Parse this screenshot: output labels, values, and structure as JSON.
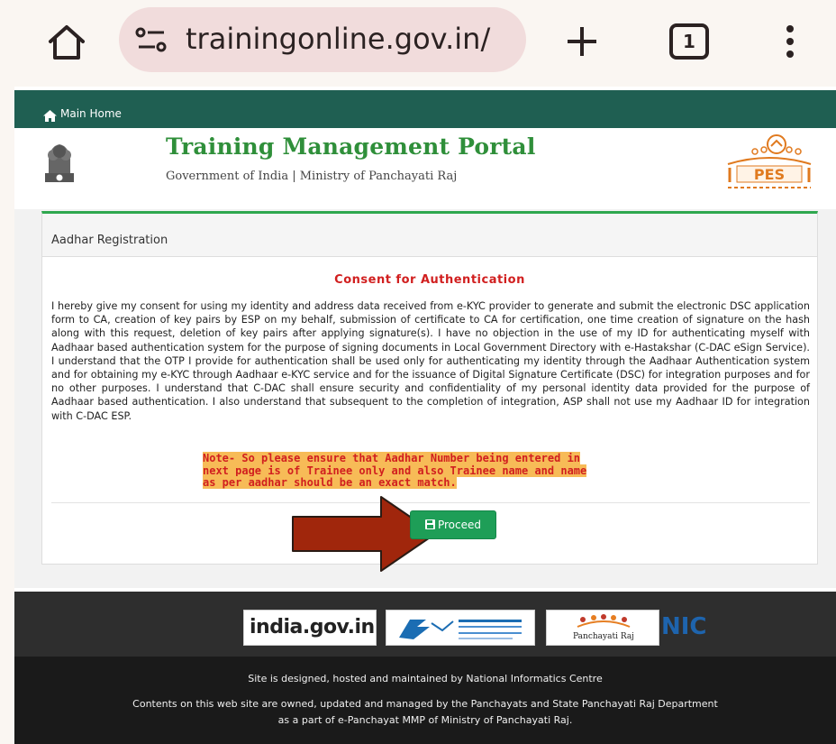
{
  "browser": {
    "url": "trainingonline.gov.in/",
    "tab_count": "1"
  },
  "nav": {
    "home_link": "Main Home"
  },
  "header": {
    "title": "Training Management Portal",
    "subtitle": "Government of India | Ministry of Panchayati Raj",
    "emblem_caption": "सत्यमेव जयते",
    "right_logo_text": "PES"
  },
  "card": {
    "title": "Aadhar Registration",
    "consent_title": "Consent for Authentication",
    "consent_text": "I hereby give my consent for using my identity and address data received from e-KYC provider to generate and submit the electronic DSC application form to CA, creation of key pairs by ESP on my behalf, submission of certificate to CA for certification, one time creation of signature on the hash along with this request, deletion of key pairs after applying signature(s). I have no objection in the use of my ID for authenticating myself with Aadhaar based authentication system for the purpose of signing documents in Local Government Directory with e-Hastakshar (C-DAC eSign Service). I understand that the OTP I provide for authentication shall be used only for authenticating my identity through the Aadhaar Authentication system and for obtaining my e-KYC through Aadhaar e-KYC service and for the issuance of Digital Signature Certificate (DSC) for integration purposes and for no other purposes. I understand that C-DAC shall ensure security and confidentiality of my personal identity data provided for the purpose of Aadhaar based authentication. I also understand that subsequent to the completion of integration, ASP shall not use my Aadhaar ID for integration with C-DAC ESP.",
    "note_line1": "Note- So please ensure that Aadhar Number being entered in",
    "note_line2": "next page is of Trainee only and also Trainee name and name",
    "note_line3": "as per aadhar should be an exact match.",
    "proceed_label": "Proceed"
  },
  "logos": {
    "india_gov": "india.gov.in",
    "panchayati_raj": "Panchayati Raj",
    "nic": "NIC"
  },
  "footer": {
    "line1": "Site is designed, hosted and maintained by National Informatics Centre",
    "line2": "Contents on this web site are owned, updated and managed by the Panchayats and State Panchayati Raj Department",
    "line3": "as a part of e-Panchayat MMP of Ministry of Panchayati Raj."
  },
  "colors": {
    "nav_bg": "#1f5f52",
    "title_green": "#2f8f3a",
    "consent_red": "#d11f1f",
    "note_highlight": "#f7bb57",
    "proceed_green": "#1e9e57",
    "arrow_red": "#a0260c"
  }
}
